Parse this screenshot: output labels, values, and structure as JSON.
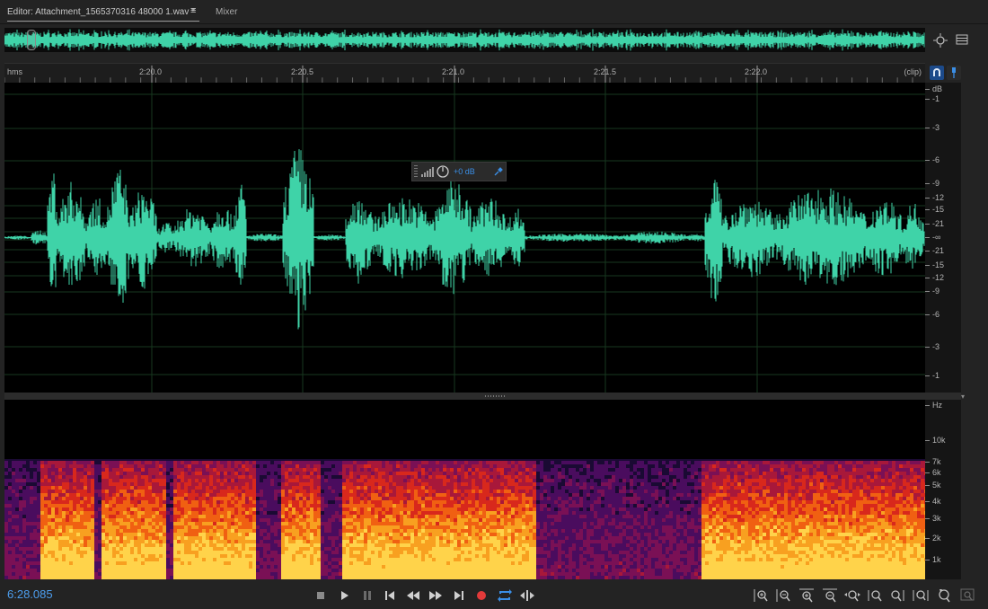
{
  "tabs": {
    "editor_label": "Editor: Attachment_1565370316 48000 1.wav *",
    "menu_glyph": "≡",
    "mixer_label": "Mixer"
  },
  "ruler": {
    "unit": "hms",
    "ticks": [
      "2:20.0",
      "2:20.5",
      "2:21.0",
      "2:21.5",
      "2:22.0"
    ],
    "clip_label": "(clip)"
  },
  "db_scale": {
    "unit": "dB",
    "labels": [
      "-1",
      "-3",
      "-6",
      "-9",
      "-12",
      "-15",
      "-21",
      "-∞",
      "-21",
      "-15",
      "-12",
      "-9",
      "-6",
      "-3",
      "-1"
    ]
  },
  "hud": {
    "value": "+0 dB"
  },
  "hz_scale": {
    "unit": "Hz",
    "labels": [
      "10k",
      "7k",
      "6k",
      "5k",
      "4k",
      "3k",
      "2k",
      "1k"
    ]
  },
  "transport": {
    "timecode": "6:28.085",
    "buttons": [
      "stop",
      "play",
      "pause",
      "move-to-previous",
      "rewind",
      "fast-forward",
      "move-to-next",
      "record",
      "loop-playback",
      "skip-selection"
    ]
  },
  "zoom_tools": [
    "zoom-in-amplitude",
    "zoom-out-amplitude",
    "zoom-in-time",
    "zoom-out-time",
    "zoom-out-full",
    "zoom-in-at-start",
    "zoom-in-at-end",
    "zoom-to-selection",
    "reset-zoom",
    "zoom-to-clip"
  ],
  "colors": {
    "waveform": "#3fd3a8",
    "timecode": "#4d9ff0",
    "record": "#e23a3a",
    "accent": "#1c4a8a"
  }
}
